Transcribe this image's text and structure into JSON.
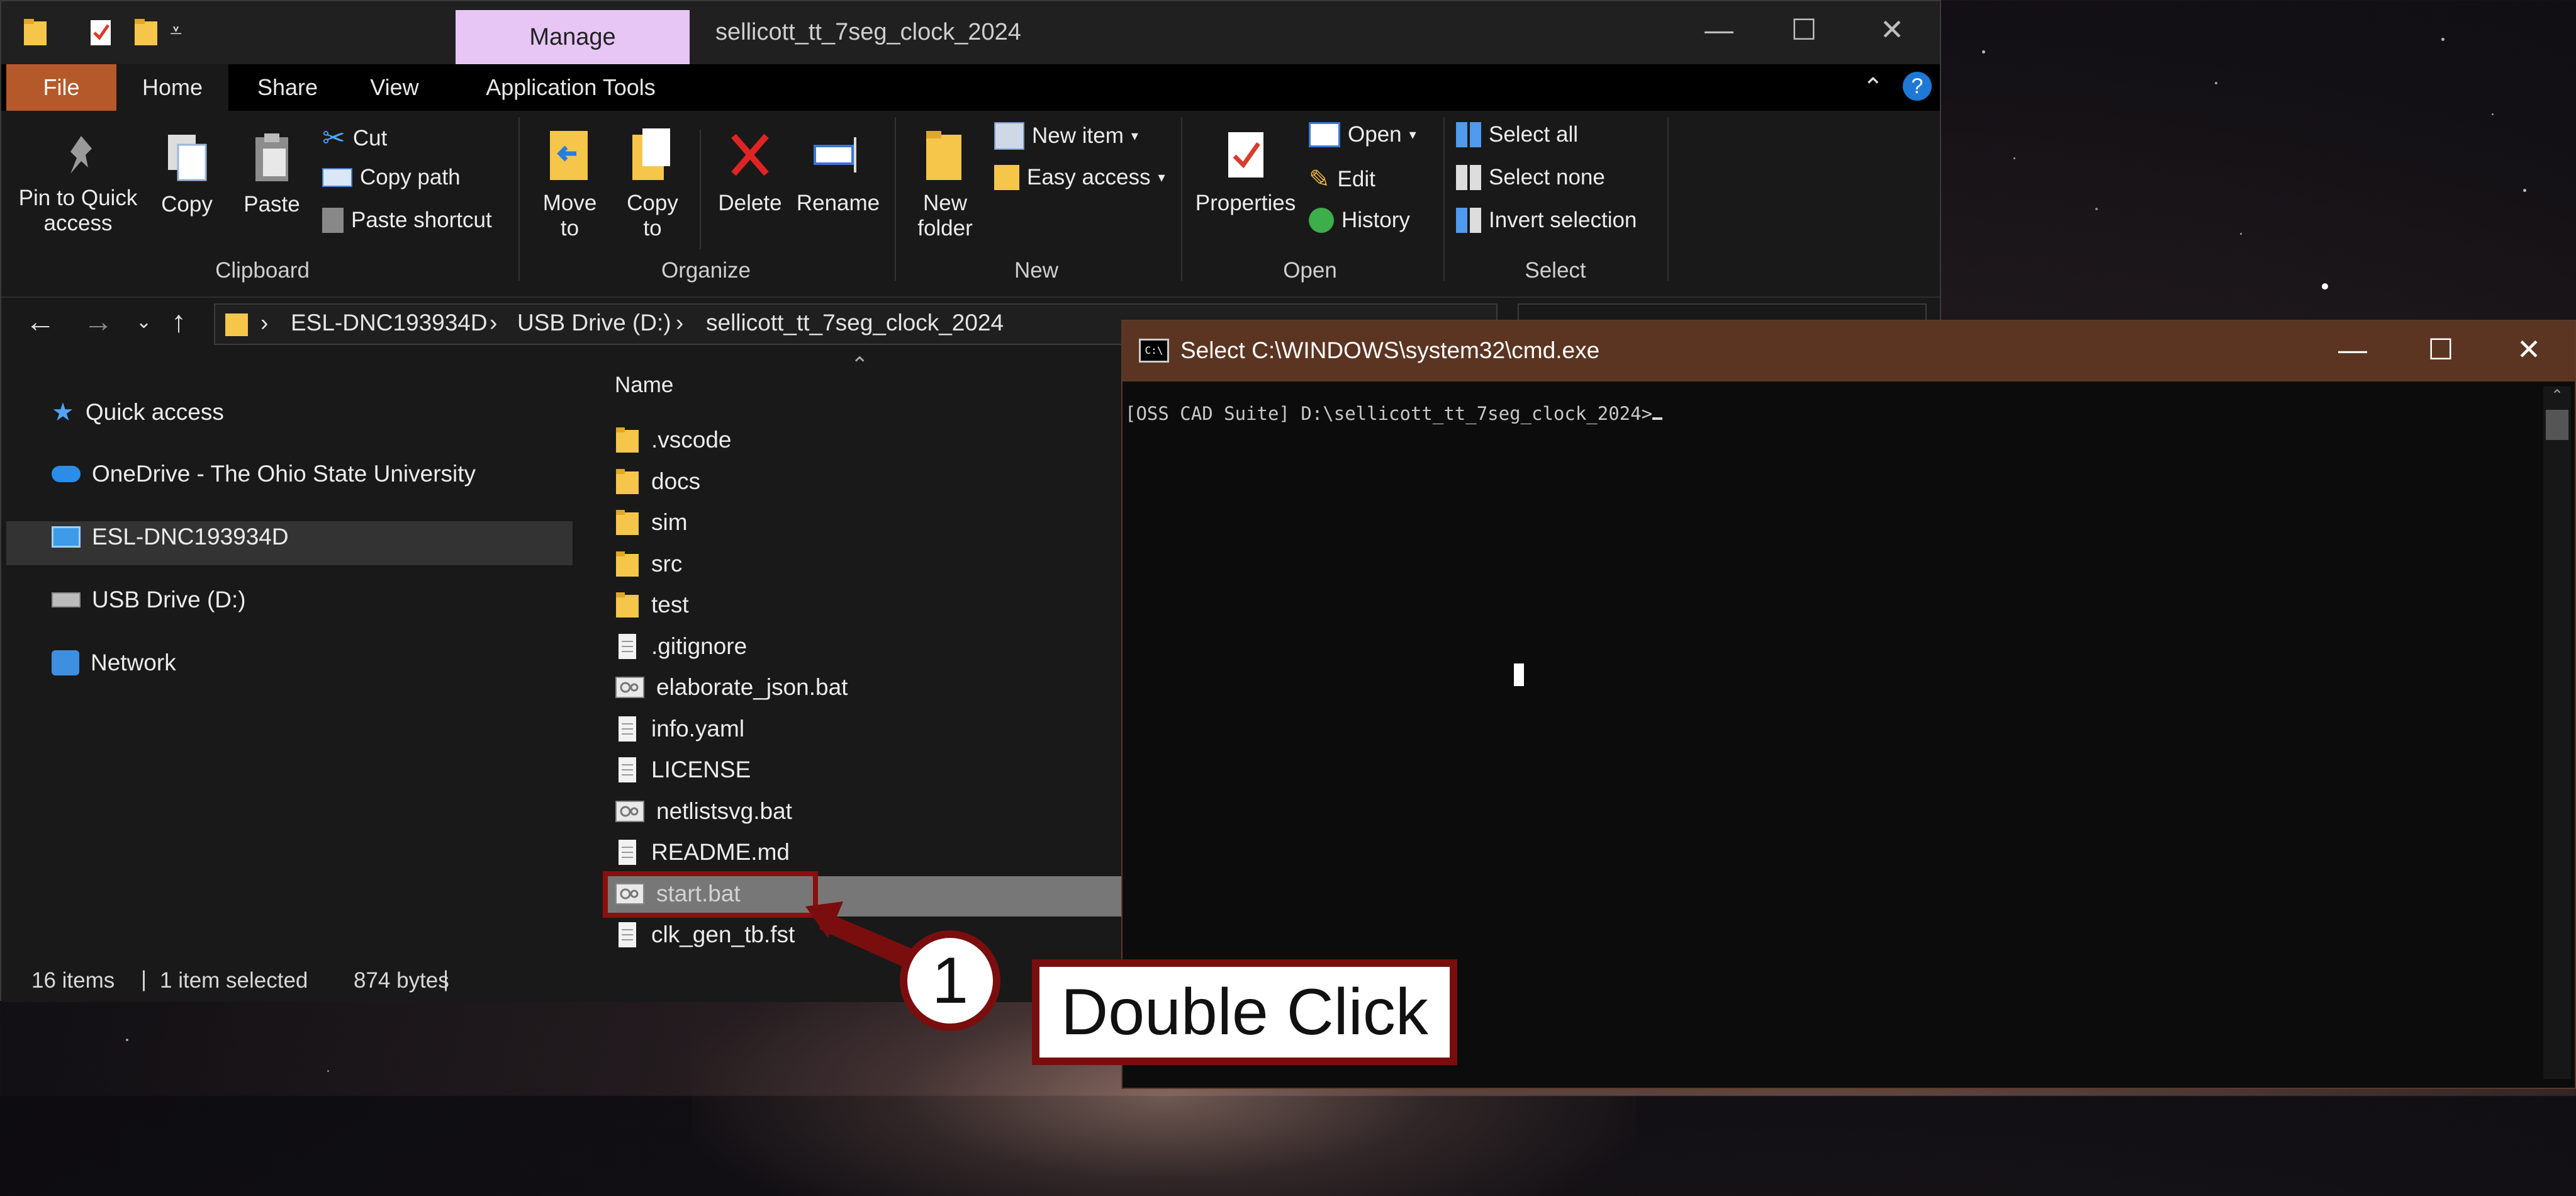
{
  "colors": {
    "accent_file_tab": "#b5592a",
    "manage_tab": "#e7c6f6",
    "cmd_title": "#5b3522",
    "annotation_red": "#7a0e0e"
  },
  "titlebar": {
    "manage_label": "Manage",
    "window_title": "sellicott_tt_7seg_clock_2024",
    "minimize": "—",
    "maximize": "☐",
    "close": "✕"
  },
  "tabs": {
    "file": "File",
    "home": "Home",
    "share": "Share",
    "view": "View",
    "app_tools": "Application Tools"
  },
  "ribbon": {
    "clipboard": {
      "pin": "Pin to Quick access",
      "copy": "Copy",
      "paste": "Paste",
      "cut": "Cut",
      "copy_path": "Copy path",
      "paste_shortcut": "Paste shortcut",
      "label": "Clipboard"
    },
    "organize": {
      "move_to": "Move to",
      "copy_to": "Copy to",
      "delete": "Delete",
      "rename": "Rename",
      "label": "Organize"
    },
    "new": {
      "new_folder": "New folder",
      "new_item": "New item",
      "easy_access": "Easy access",
      "label": "New"
    },
    "open": {
      "properties": "Properties",
      "open": "Open",
      "edit": "Edit",
      "history": "History",
      "label": "Open"
    },
    "select": {
      "select_all": "Select all",
      "select_none": "Select none",
      "invert_selection": "Invert selection",
      "label": "Select"
    }
  },
  "address": {
    "crumbs": [
      "ESL-DNC193934D",
      "USB Drive (D:)",
      "sellicott_tt_7seg_clock_2024"
    ]
  },
  "nav": [
    "Quick access",
    "OneDrive - The Ohio State University",
    "ESL-DNC193934D",
    "USB Drive (D:)",
    "Network"
  ],
  "files": {
    "column_name": "Name",
    "items": [
      ".vscode",
      "docs",
      "sim",
      "src",
      "test",
      ".gitignore",
      "elaborate_json.bat",
      "info.yaml",
      "LICENSE",
      "netlistsvg.bat",
      "README.md",
      "start.bat",
      "clk_gen_tb.fst"
    ],
    "icons": [
      "folder-icon",
      "folder-icon",
      "folder-icon",
      "folder-icon",
      "folder-icon",
      "text-file-icon",
      "batch-file-icon",
      "text-file-icon",
      "text-file-icon",
      "batch-file-icon",
      "text-file-icon",
      "batch-file-icon",
      "text-file-icon"
    ]
  },
  "status": {
    "items": "16 items",
    "selected": "1 item selected",
    "size": "874 bytes"
  },
  "cmd": {
    "title": "Select C:\\WINDOWS\\system32\\cmd.exe",
    "prompt": "[OSS CAD Suite] D:\\sellicott_tt_7seg_clock_2024>"
  },
  "annotation": {
    "step": "1",
    "label": "Double Click"
  }
}
